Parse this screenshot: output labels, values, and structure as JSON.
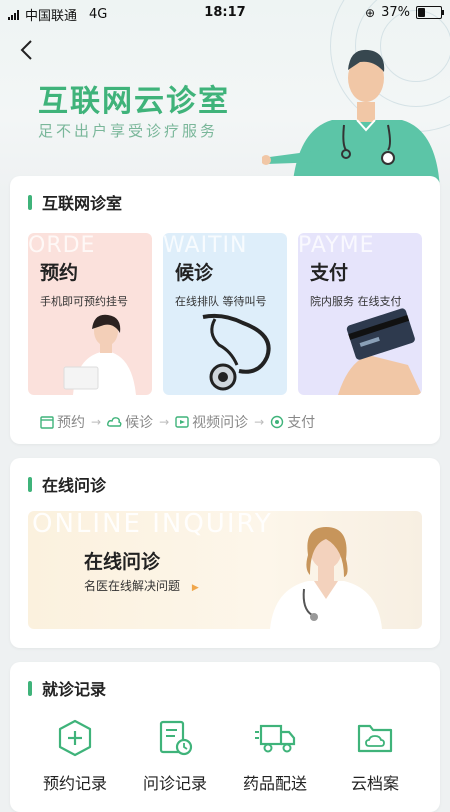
{
  "status": {
    "carrier": "中国联通",
    "network": "4G",
    "time": "18:17",
    "battery": "37%",
    "battery_level": 0.37
  },
  "hero": {
    "title": "互联网云诊室",
    "subtitle": "足不出户享受诊疗服务"
  },
  "clinic": {
    "title": "互联网诊室",
    "tiles": [
      {
        "title": "预约",
        "subtitle": "手机即可预约挂号",
        "watermark": "ORDE",
        "bg": "#fbe1dc"
      },
      {
        "title": "候诊",
        "subtitle": "在线排队 等待叫号",
        "watermark": "WAITIN",
        "bg": "#deeefa"
      },
      {
        "title": "支付",
        "subtitle": "院内服务 在线支付",
        "watermark": "PAYME",
        "bg": "#e6e4fb"
      }
    ],
    "steps": [
      "预约",
      "候诊",
      "视频问诊",
      "支付"
    ]
  },
  "inquiry": {
    "title": "在线问诊",
    "banner_title": "在线问诊",
    "banner_subtitle": "名医在线解决问题",
    "watermark": "ONLINE INQUIRY"
  },
  "records": {
    "title": "就诊记录",
    "items": [
      {
        "label": "预约记录",
        "icon": "plus-circle-icon"
      },
      {
        "label": "问诊记录",
        "icon": "record-clock-icon"
      },
      {
        "label": "药品配送",
        "icon": "truck-icon"
      },
      {
        "label": "云档案",
        "icon": "cloud-folder-icon"
      }
    ]
  },
  "colors": {
    "accent": "#3fb37a"
  }
}
